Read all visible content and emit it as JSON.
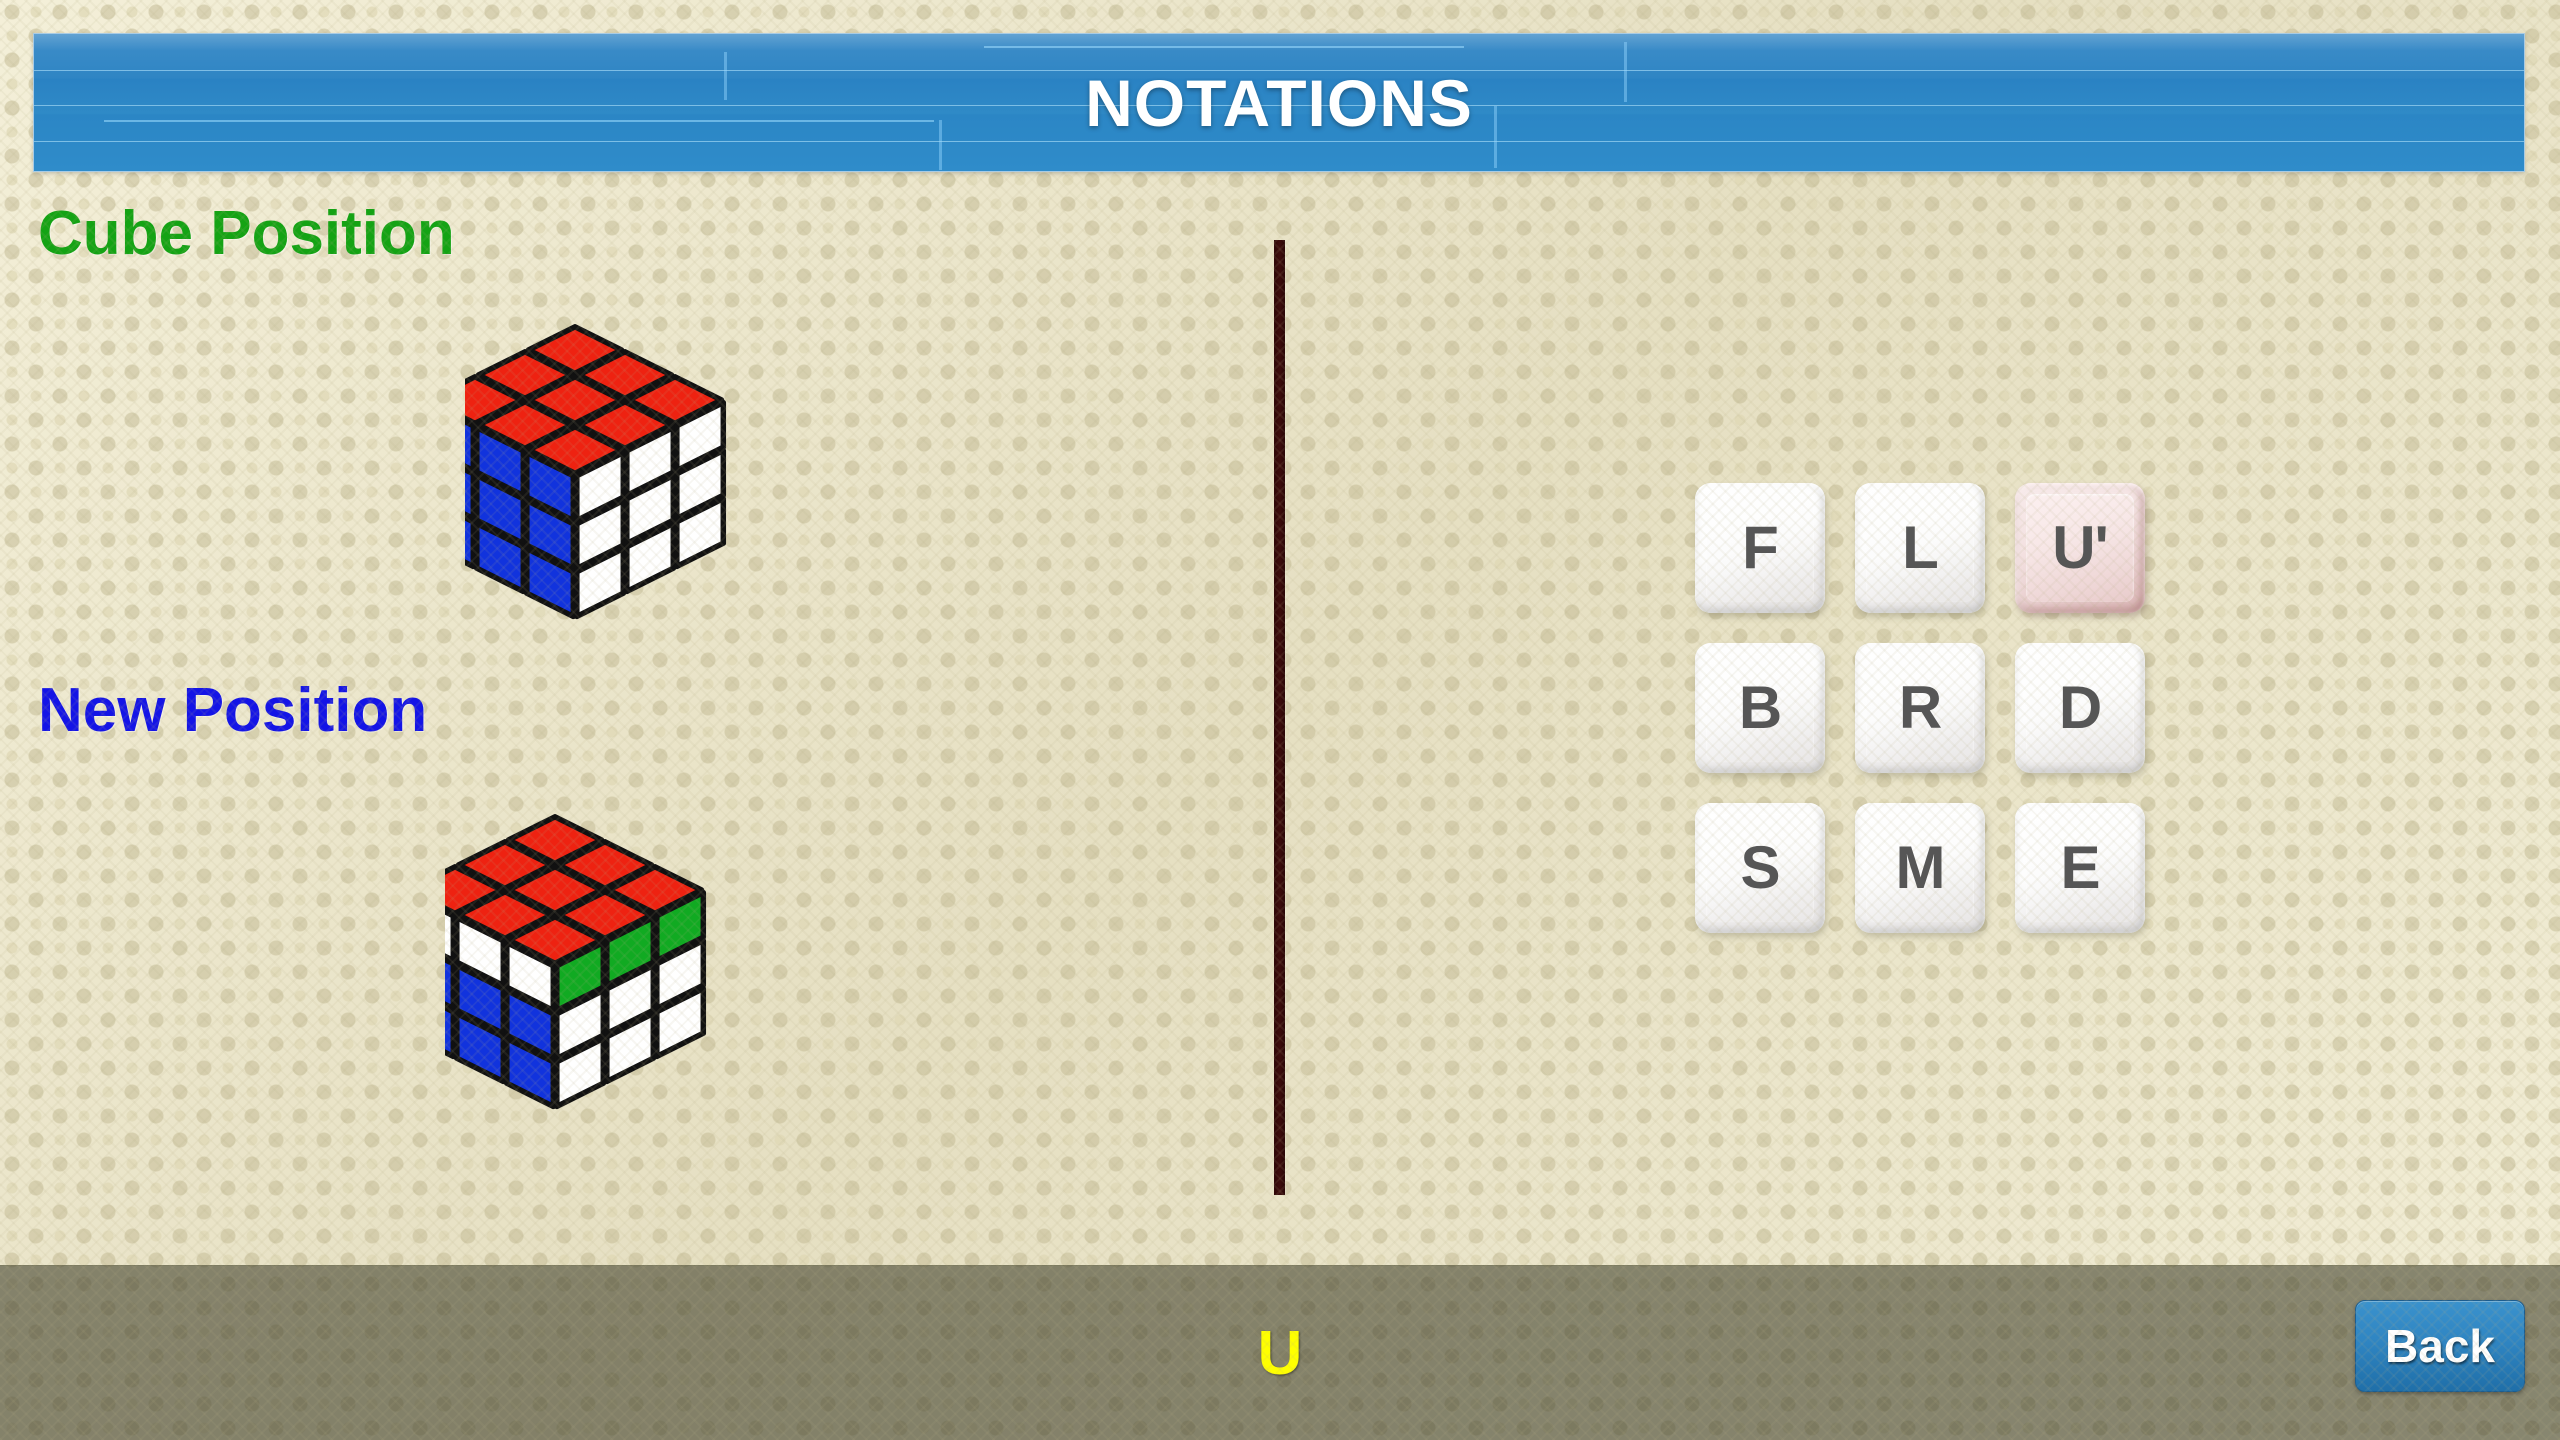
{
  "header": {
    "title": "NOTATIONS"
  },
  "sections": {
    "cube_position_label": "Cube Position",
    "new_position_label": "New Position"
  },
  "colors": {
    "cube_position_label": "#14a314",
    "new_position_label": "#1414e6",
    "current_move": "#ffff00",
    "divider": "#2e0707",
    "header_blue": "#2f85c4",
    "key_highlight": "#e9cfcf",
    "cube_red": "#ee2211",
    "cube_blue": "#1133dd",
    "cube_white": "#ffffff",
    "cube_green": "#11aa22",
    "cube_edge": "#111111"
  },
  "cubes": {
    "current": {
      "name": "cube-position-diagram",
      "top_face": [
        [
          "red",
          "red",
          "red"
        ],
        [
          "red",
          "red",
          "red"
        ],
        [
          "red",
          "red",
          "red"
        ]
      ],
      "left_face": [
        [
          "blue",
          "blue",
          "blue"
        ],
        [
          "blue",
          "blue",
          "blue"
        ],
        [
          "blue",
          "blue",
          "blue"
        ]
      ],
      "right_face": [
        [
          "white",
          "white",
          "white"
        ],
        [
          "white",
          "white",
          "white"
        ],
        [
          "white",
          "white",
          "white"
        ]
      ]
    },
    "next": {
      "name": "new-position-diagram",
      "top_face": [
        [
          "red",
          "red",
          "red"
        ],
        [
          "red",
          "red",
          "red"
        ],
        [
          "red",
          "red",
          "red"
        ]
      ],
      "left_face": [
        [
          "white",
          "white",
          "white"
        ],
        [
          "blue",
          "blue",
          "blue"
        ],
        [
          "blue",
          "blue",
          "blue"
        ]
      ],
      "right_face": [
        [
          "green",
          "green",
          "green"
        ],
        [
          "white",
          "white",
          "white"
        ],
        [
          "white",
          "white",
          "white"
        ]
      ]
    }
  },
  "keypad": {
    "keys": [
      {
        "label": "F",
        "highlighted": false
      },
      {
        "label": "L",
        "highlighted": false
      },
      {
        "label": "U'",
        "highlighted": true
      },
      {
        "label": "B",
        "highlighted": false
      },
      {
        "label": "R",
        "highlighted": false
      },
      {
        "label": "D",
        "highlighted": false
      },
      {
        "label": "S",
        "highlighted": false
      },
      {
        "label": "M",
        "highlighted": false
      },
      {
        "label": "E",
        "highlighted": false
      }
    ]
  },
  "footer": {
    "current_move": "U",
    "back_label": "Back"
  }
}
